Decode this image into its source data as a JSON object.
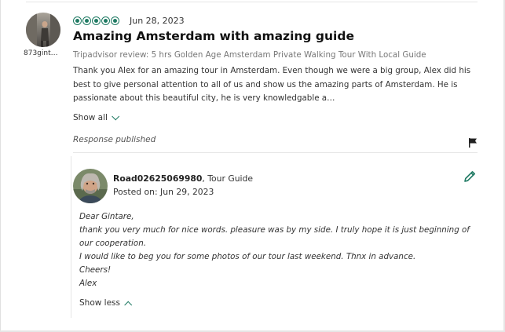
{
  "review": {
    "username": "873gint…",
    "rating": 5,
    "date": "Jun 28, 2023",
    "title": "Amazing Amsterdam with amazing guide",
    "subtitle": "Tripadvisor review: 5 hrs Golden Age Amsterdam Private Walking Tour With Local Guide",
    "body": "Thank you Alex for an amazing tour in Amsterdam. Even though we were a big group, Alex did his best to give personal attention to all of us and show us the amazing parts of Amsterdam. He is passionate about this beautiful city, he is very knowledgable a…",
    "show_all_label": "Show all",
    "response_status": "Response published"
  },
  "response": {
    "author": "Road02625069980",
    "role_suffix": ", Tour Guide",
    "posted_on": "Posted on: Jun 29, 2023",
    "lines": [
      "Dear Gintare,",
      "thank you very much for nice words. pleasure was by my side. I truly hope it is just beginning of our cooperation.",
      "I would like to beg you for some photos of our tour last weekend. Thnx in advance.",
      "Cheers!",
      "Alex"
    ],
    "show_less_label": "Show less"
  },
  "icons": {
    "rating": "rating-bubble-icon",
    "flag": "flag-icon",
    "edit": "pencil-icon",
    "chevron_down": "chevron-down-icon",
    "chevron_up": "chevron-up-icon"
  },
  "colors": {
    "accent": "#1f7a63",
    "text": "#333333",
    "muted": "#777777"
  }
}
